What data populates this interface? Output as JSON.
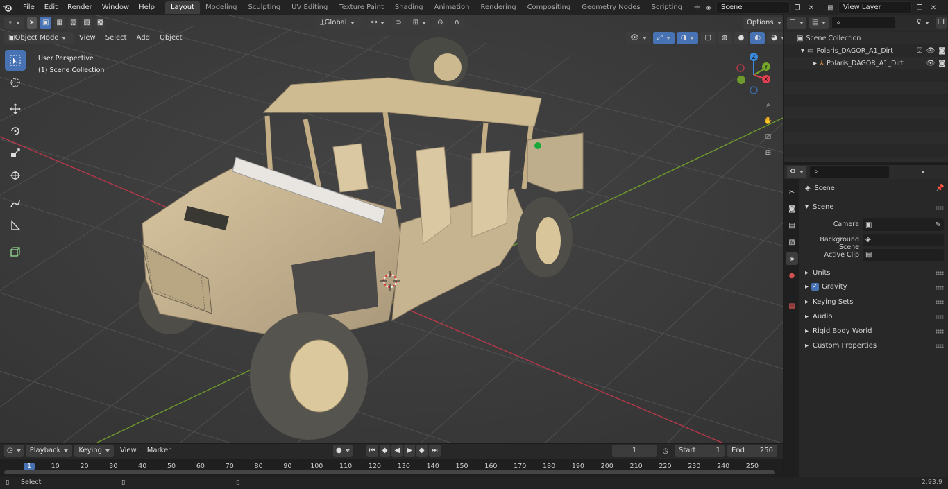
{
  "menus": [
    "File",
    "Edit",
    "Render",
    "Window",
    "Help"
  ],
  "workspaces": [
    "Layout",
    "Modeling",
    "Sculpting",
    "UV Editing",
    "Texture Paint",
    "Shading",
    "Animation",
    "Rendering",
    "Compositing",
    "Geometry Nodes",
    "Scripting"
  ],
  "scene_name": "Scene",
  "view_layer": "View Layer",
  "viewport": {
    "mode": "Object Mode",
    "menus": [
      "View",
      "Select",
      "Add",
      "Object"
    ],
    "orientation": "Global",
    "options": "Options",
    "overlay_line1": "User Perspective",
    "overlay_line2": "(1) Scene Collection"
  },
  "outliner": {
    "root": "Scene Collection",
    "collection": "Polaris_DAGOR_A1_Dirt",
    "object": "Polaris_DAGOR_A1_Dirt"
  },
  "properties": {
    "header": "Scene",
    "section": "Scene",
    "camera_label": "Camera",
    "bg_label": "Background Scene",
    "clip_label": "Active Clip",
    "panels": [
      "Units",
      "Gravity",
      "Keying Sets",
      "Audio",
      "Rigid Body World",
      "Custom Properties"
    ]
  },
  "timeline": {
    "menus": [
      "Playback",
      "Keying",
      "View",
      "Marker"
    ],
    "current_frame": "1",
    "start_label": "Start",
    "start": "1",
    "end_label": "End",
    "end": "250",
    "ticks": [
      "1",
      "10",
      "20",
      "30",
      "40",
      "50",
      "60",
      "70",
      "80",
      "90",
      "100",
      "110",
      "120",
      "130",
      "140",
      "150",
      "160",
      "170",
      "180",
      "190",
      "200",
      "210",
      "220",
      "230",
      "240",
      "250"
    ]
  },
  "status": {
    "left": "Select",
    "version": "2.93.9"
  },
  "axes": {
    "x": "X",
    "y": "Y",
    "z": "Z"
  },
  "colors": {
    "accent": "#4772b3",
    "x_axis": "#e04050",
    "y_axis": "#76a82a",
    "z_axis": "#3b88d8",
    "vehicle": "#c9b48f"
  }
}
